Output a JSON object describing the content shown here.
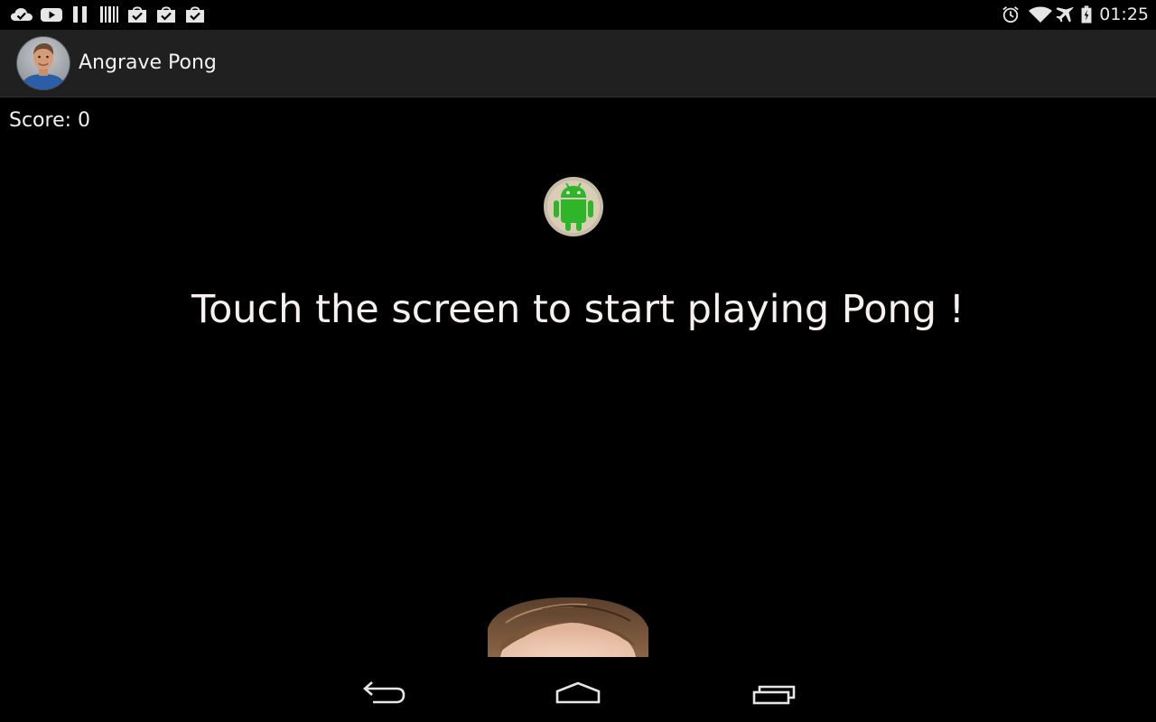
{
  "status_bar": {
    "time": "01:25",
    "left_icons": [
      "cloud-check-icon",
      "youtube-icon",
      "pause-icon",
      "barcode-icon",
      "shopping-bag-check-icon",
      "shopping-bag-check-icon",
      "shopping-bag-check-icon"
    ],
    "right_icons": [
      "alarm-icon",
      "wifi-icon",
      "airplane-mode-icon",
      "battery-icon"
    ]
  },
  "action_bar": {
    "title": "Angrave Pong",
    "avatar_icon": "app-avatar-photo"
  },
  "game": {
    "score_text": "Score: 0",
    "message": "Touch the screen to start playing Pong !",
    "ball_icon": "android-robot-icon",
    "paddle_icon": "face-photo-paddle"
  },
  "nav_bar": {
    "buttons": [
      "back-icon",
      "home-icon",
      "recents-icon"
    ]
  },
  "colors": {
    "background": "#000000",
    "action_bar": "#202020",
    "android_green": "#2fb52a",
    "ball_ring": "#c8bca6",
    "text": "#f6f0ee"
  }
}
